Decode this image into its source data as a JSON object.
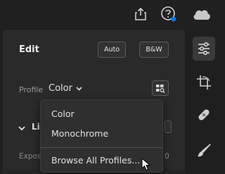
{
  "edit_panel": {
    "title": "Edit",
    "auto_label": "Auto",
    "bw_label": "B&W",
    "profile_label": "Profile",
    "profile_value": "Color",
    "section_label": "Light",
    "slider_label": "Exposure",
    "slider_value": "0"
  },
  "profile_dropdown": {
    "items": [
      "Color",
      "Monochrome"
    ],
    "browse_label": "Browse All Profiles..."
  },
  "topbar": {
    "icons": [
      "share-icon",
      "help-icon",
      "cloud-icon"
    ],
    "notification_color": "#1473e6"
  },
  "toolbar": {
    "icons": [
      "adjust-sliders-icon",
      "crop-rotate-icon",
      "healing-bandage-icon",
      "brush-icon"
    ],
    "active": "adjust-sliders-icon"
  }
}
